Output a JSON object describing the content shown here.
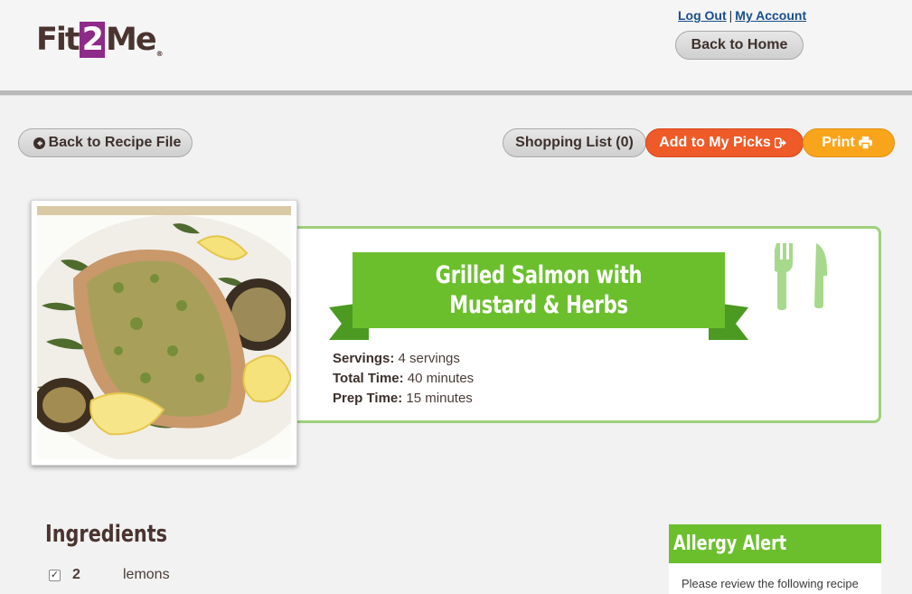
{
  "header": {
    "logo_pre": "Fit",
    "logo_mid": "2",
    "logo_post": "Me",
    "logo_mark": "®",
    "logout": "Log Out",
    "separator": "|",
    "my_account": "My Account",
    "back_home": "Back to Home"
  },
  "toolbar": {
    "back_recipe": "Back to Recipe File",
    "shopping_list": "Shopping List (0)",
    "add_picks": "Add to My Picks",
    "print": "Print"
  },
  "recipe": {
    "title": "Grilled Salmon with Mustard & Herbs",
    "servings_label": "Servings:",
    "servings": "4 servings",
    "total_label": "Total Time:",
    "total": "40 minutes",
    "prep_label": "Prep Time:",
    "prep": "15 minutes"
  },
  "ingredients": {
    "title": "Ingredients",
    "items": [
      {
        "checked": true,
        "check_glyph": "✓",
        "qty": "2",
        "name": "lemons"
      }
    ]
  },
  "allergy": {
    "title": "Allergy Alert",
    "text": "Please review the following recipe"
  },
  "colors": {
    "green": "#6bbf2d",
    "light_green": "#9ed07c",
    "orange": "#ee5a28",
    "yellow": "#f9a51b",
    "brand_purple": "#8e2a8a"
  },
  "icons": [
    "arrow-circle-left-icon",
    "sign-in-icon",
    "print-icon",
    "fork-knife-icon"
  ]
}
